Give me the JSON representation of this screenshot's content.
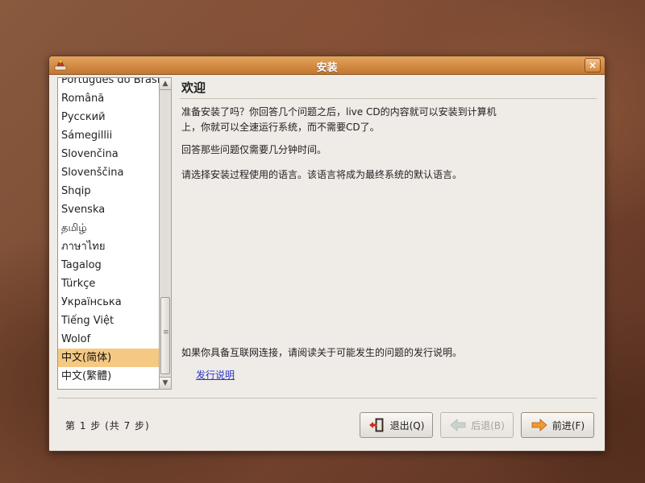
{
  "window": {
    "title": "安装",
    "close_label": "×"
  },
  "languages": [
    {
      "label": "Português do Brasil"
    },
    {
      "label": "Română"
    },
    {
      "label": "Русский"
    },
    {
      "label": "Sámegillii"
    },
    {
      "label": "Slovenčina"
    },
    {
      "label": "Slovenščina"
    },
    {
      "label": "Shqip"
    },
    {
      "label": "Svenska"
    },
    {
      "label": "தமிழ்"
    },
    {
      "label": "ภาษาไทย"
    },
    {
      "label": "Tagalog"
    },
    {
      "label": "Türkçe"
    },
    {
      "label": "Українська"
    },
    {
      "label": "Tiếng Việt"
    },
    {
      "label": "Wolof"
    },
    {
      "label": "中文(简体)",
      "selected": true
    },
    {
      "label": "中文(繁體)"
    }
  ],
  "content": {
    "title": "欢迎",
    "para1": "准备安装了吗？你回答几个问题之后，live CD的内容就可以安装到计算机上，你就可以全速运行系统，而不需要CD了。",
    "para2": "回答那些问题仅需要几分钟时间。",
    "para3": "请选择安装过程使用的语言。该语言将成为最终系统的默认语言。",
    "para4": "如果你具备互联网连接，请阅读关于可能发生的问题的发行说明。",
    "release_notes_link": "发行说明"
  },
  "footer": {
    "step_text": "第 1 步 (共 7 步)",
    "quit_label": "退出(Q)",
    "back_label": "后退(B)",
    "forward_label": "前进(F)"
  },
  "colors": {
    "titlebar": "#d08a44",
    "selection": "#f5c983",
    "link": "#2a35c8",
    "window_bg": "#efebe7"
  }
}
